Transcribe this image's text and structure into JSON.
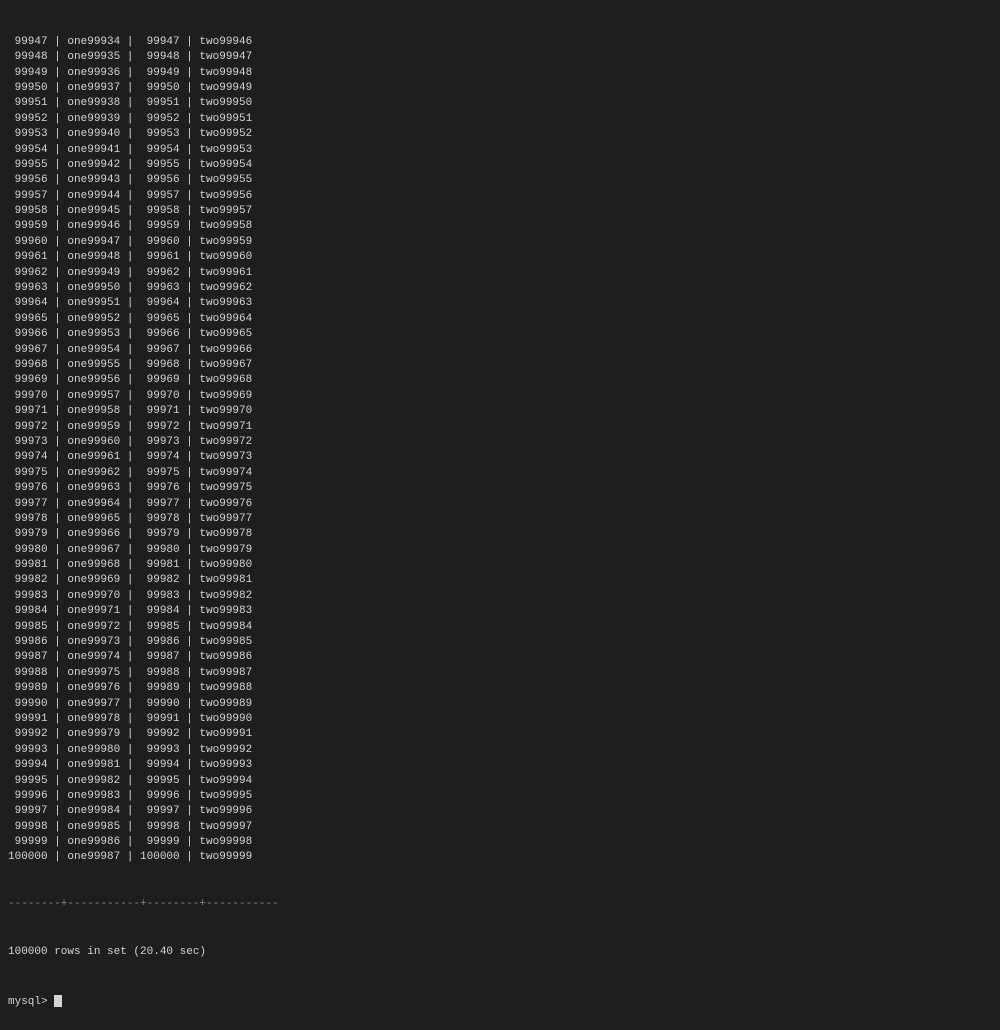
{
  "terminal": {
    "rows": [
      " 99947 | one99934 |  99947 | two99946",
      " 99948 | one99935 |  99948 | two99947",
      " 99949 | one99936 |  99949 | two99948",
      " 99950 | one99937 |  99950 | two99949",
      " 99951 | one99938 |  99951 | two99950",
      " 99952 | one99939 |  99952 | two99951",
      " 99953 | one99940 |  99953 | two99952",
      " 99954 | one99941 |  99954 | two99953",
      " 99955 | one99942 |  99955 | two99954",
      " 99956 | one99943 |  99956 | two99955",
      " 99957 | one99944 |  99957 | two99956",
      " 99958 | one99945 |  99958 | two99957",
      " 99959 | one99946 |  99959 | two99958",
      " 99960 | one99947 |  99960 | two99959",
      " 99961 | one99948 |  99961 | two99960",
      " 99962 | one99949 |  99962 | two99961",
      " 99963 | one99950 |  99963 | two99962",
      " 99964 | one99951 |  99964 | two99963",
      " 99965 | one99952 |  99965 | two99964",
      " 99966 | one99953 |  99966 | two99965",
      " 99967 | one99954 |  99967 | two99966",
      " 99968 | one99955 |  99968 | two99967",
      " 99969 | one99956 |  99969 | two99968",
      " 99970 | one99957 |  99970 | two99969",
      " 99971 | one99958 |  99971 | two99970",
      " 99972 | one99959 |  99972 | two99971",
      " 99973 | one99960 |  99973 | two99972",
      " 99974 | one99961 |  99974 | two99973",
      " 99975 | one99962 |  99975 | two99974",
      " 99976 | one99963 |  99976 | two99975",
      " 99977 | one99964 |  99977 | two99976",
      " 99978 | one99965 |  99978 | two99977",
      " 99979 | one99966 |  99979 | two99978",
      " 99980 | one99967 |  99980 | two99979",
      " 99981 | one99968 |  99981 | two99980",
      " 99982 | one99969 |  99982 | two99981",
      " 99983 | one99970 |  99983 | two99982",
      " 99984 | one99971 |  99984 | two99983",
      " 99985 | one99972 |  99985 | two99984",
      " 99986 | one99973 |  99986 | two99985",
      " 99987 | one99974 |  99987 | two99986",
      " 99988 | one99975 |  99988 | two99987",
      " 99989 | one99976 |  99989 | two99988",
      " 99990 | one99977 |  99990 | two99989",
      " 99991 | one99978 |  99991 | two99990",
      " 99992 | one99979 |  99992 | two99991",
      " 99993 | one99980 |  99993 | two99992",
      " 99994 | one99981 |  99994 | two99993",
      " 99995 | one99982 |  99995 | two99994",
      " 99996 | one99983 |  99996 | two99995",
      " 99997 | one99984 |  99997 | two99996",
      " 99998 | one99985 |  99998 | two99997",
      " 99999 | one99986 |  99999 | two99998",
      "100000 | one99987 | 100000 | two99999"
    ],
    "separator": "--------+-----------+--------+-----------",
    "summary": "100000 rows in set (20.40 sec)",
    "prompt": "mysql> "
  }
}
